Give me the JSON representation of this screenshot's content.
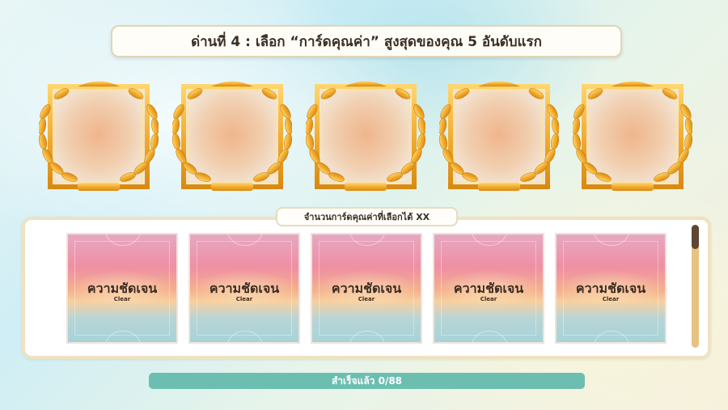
{
  "title": "ด่านที่ 4 : เลือก “การ์ดคุณค่า” สูงสุดของคุณ 5 อันดับแรก",
  "frames": [
    {
      "slot": 1
    },
    {
      "slot": 2
    },
    {
      "slot": 3
    },
    {
      "slot": 4
    },
    {
      "slot": 5
    }
  ],
  "card_panel": {
    "label": "จำนวนการ์ดคุณค่าที่เลือกได้ XX"
  },
  "cards": [
    {
      "name": "ความชัดเจน",
      "subtitle": "Clear"
    },
    {
      "name": "ความชัดเจน",
      "subtitle": "Clear"
    },
    {
      "name": "ความชัดเจน",
      "subtitle": "Clear"
    },
    {
      "name": "ความชัดเจน",
      "subtitle": "Clear"
    },
    {
      "name": "ความชัดเจน",
      "subtitle": "Clear"
    }
  ],
  "progress": {
    "label": "สำเร็จแล้ว 0/88",
    "completed": 0,
    "total": 88
  },
  "colors": {
    "gold": "#f0b23a",
    "progress_bar": "#6cbfb0",
    "scroll_track": "#e7c283",
    "scroll_thumb": "#5e4632"
  }
}
